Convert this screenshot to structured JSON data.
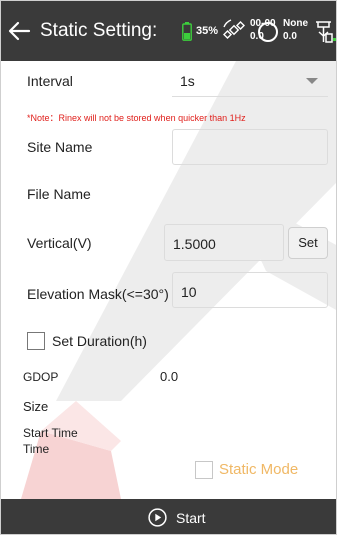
{
  "header": {
    "title": "Static Setting:",
    "battery": "35%",
    "satellites_top": "00-00",
    "satellites_bottom": "0.0",
    "solution_top": "None",
    "solution_bottom": "0.0",
    "icons": [
      "back-arrow-icon",
      "battery-icon",
      "satellite-icon",
      "circle-status-icon",
      "rover-receiver-icon"
    ]
  },
  "form": {
    "interval": {
      "label": "Interval",
      "value": "1s"
    },
    "note": "*Note：Rinex will not be stored when quicker than 1Hz",
    "site_name": {
      "label": "Site Name",
      "value": ""
    },
    "file_name": {
      "label": "File Name"
    },
    "vertical": {
      "label": "Vertical(V)",
      "value": "1.5000",
      "button": "Set"
    },
    "elevation_mask": {
      "label": "Elevation Mask(<=30°)",
      "value": "10"
    },
    "set_duration": {
      "label": "Set Duration(h)",
      "checked": false
    },
    "gdop": {
      "label": "GDOP",
      "value": "0.0"
    },
    "size": {
      "label": "Size"
    },
    "start_time": {
      "label": "Start Time"
    },
    "time": {
      "label": "Time"
    },
    "static_mode": {
      "label": "Static Mode",
      "checked": false,
      "disabled": true
    }
  },
  "bottom": {
    "start_label": "Start"
  },
  "colors": {
    "header_bg": "#3a3a3a",
    "note_red": "#e0201c",
    "static_mode_orange": "#f0b865",
    "battery_green": "#3ccf3c"
  }
}
